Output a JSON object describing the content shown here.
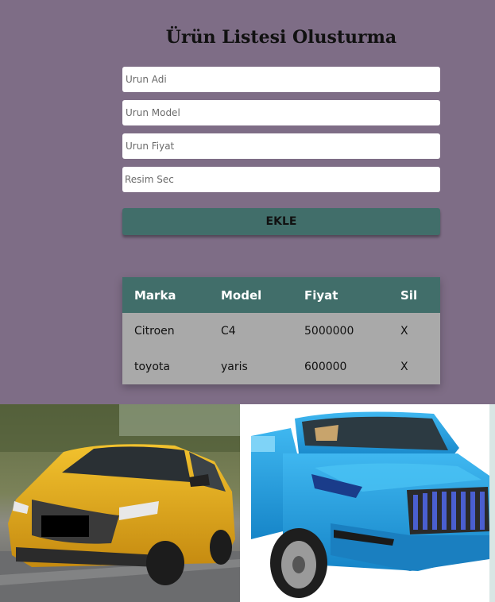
{
  "form": {
    "title": "Ürün Listesi Olusturma",
    "name_placeholder": "Urun Adi",
    "model_placeholder": "Urun Model",
    "price_placeholder": "Urun Fiyat",
    "image_label": "Resim Sec",
    "add_button": "EKLE"
  },
  "table": {
    "headers": [
      "Marka",
      "Model",
      "Fiyat",
      "Sil"
    ],
    "rows": [
      {
        "brand": "Citroen",
        "model": "C4",
        "price": "5000000",
        "delete": "X"
      },
      {
        "brand": "toyota",
        "model": "yaris",
        "price": "600000",
        "delete": "X"
      }
    ]
  },
  "images": [
    {
      "name": "yellow-car-photo"
    },
    {
      "name": "blue-toy-car-photo"
    }
  ],
  "colors": {
    "background": "#7e6d86",
    "accent": "#416e6a",
    "row": "#a9a9a9"
  }
}
